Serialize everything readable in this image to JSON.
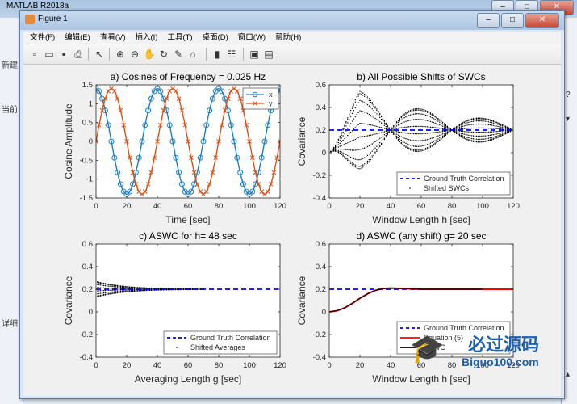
{
  "app": {
    "title": "MATLAB R2018a"
  },
  "side": {
    "left_labels": [
      "新建",
      "当前",
      "详细"
    ],
    "right_labels": [
      "?",
      "▾",
      "▴"
    ]
  },
  "figure": {
    "title": "Figure 1",
    "menus": [
      "文件(F)",
      "编辑(E)",
      "查看(V)",
      "插入(I)",
      "工具(T)",
      "桌面(D)",
      "窗口(W)",
      "帮助(H)"
    ],
    "toolbar_icons": [
      "new-file-icon",
      "open-icon",
      "save-icon",
      "print-icon",
      "pointer-icon",
      "zoom-in-icon",
      "zoom-out-icon",
      "pan-icon",
      "rotate-icon",
      "data-cursor-icon",
      "brush-icon",
      "colorbar-icon",
      "legend-icon",
      "plot-tools-hide-icon",
      "plot-tools-show-icon"
    ]
  },
  "colors": {
    "blue": "#1f7fc4",
    "orange": "#d95319",
    "gt": "#0000ff",
    "red": "#ff0000"
  },
  "chart_data": [
    {
      "type": "line",
      "title": "a) Cosines of Frequency = 0.025 Hz",
      "xlabel": "Time [sec]",
      "ylabel": "Cosine Amplitude",
      "xlim": [
        0,
        120
      ],
      "ylim": [
        -1.5,
        1.5
      ],
      "xticks": [
        "0",
        "20",
        "40",
        "60",
        "80",
        "100",
        "120"
      ],
      "yticks": [
        "-1.5",
        "-1",
        "-0.5",
        "0",
        "0.5",
        "1",
        "1.5"
      ],
      "legend_position": "top-right",
      "series": [
        {
          "name": "x",
          "frequency_hz": 0.025,
          "phase_sec": 0,
          "marker": "o",
          "color": "#1f7fc4"
        },
        {
          "name": "y",
          "frequency_hz": 0.025,
          "phase_sec": 10,
          "marker": "x",
          "color": "#d95319"
        }
      ]
    },
    {
      "type": "scatter",
      "title": "b) All Possible Shifts of SWCs",
      "xlabel": "Window Length h [sec]",
      "ylabel": "Covariance",
      "xlim": [
        0,
        120
      ],
      "ylim": [
        -0.4,
        0.6
      ],
      "xticks": [
        "0",
        "20",
        "40",
        "60",
        "80",
        "100",
        "120"
      ],
      "yticks": [
        "-0.4",
        "-0.2",
        "0",
        "0.2",
        "0.4",
        "0.6"
      ],
      "legend_position": "bottom-right",
      "ground_truth": 0.2,
      "series": [
        {
          "name": "Ground Truth Correlation",
          "style": "dashed",
          "color": "#0000ff"
        },
        {
          "name": "Shifted SWCs",
          "style": "dots",
          "color": "#000000"
        }
      ]
    },
    {
      "type": "scatter",
      "title": "c) ASWC for h= 48 sec",
      "xlabel": "Averaging Length g [sec]",
      "ylabel": "Covariance",
      "xlim": [
        0,
        120
      ],
      "ylim": [
        -0.4,
        0.6
      ],
      "xticks": [
        "0",
        "20",
        "40",
        "60",
        "80",
        "100",
        "120"
      ],
      "yticks": [
        "-0.4",
        "-0.2",
        "0",
        "0.2",
        "0.4",
        "0.6"
      ],
      "legend_position": "bottom-right",
      "ground_truth": 0.2,
      "series": [
        {
          "name": "Ground Truth Correlation",
          "style": "dashed",
          "color": "#0000ff"
        },
        {
          "name": "Shifted Averages",
          "style": "dots",
          "color": "#000000"
        }
      ]
    },
    {
      "type": "line",
      "title": "d) ASWC (any shift) g= 20 sec",
      "xlabel": "Window Length h [sec]",
      "ylabel": "Covariance",
      "xlim": [
        0,
        120
      ],
      "ylim": [
        -0.4,
        0.6
      ],
      "xticks": [
        "0",
        "20",
        "40",
        "60",
        "80",
        "100",
        "120"
      ],
      "yticks": [
        "-0.4",
        "-0.2",
        "0",
        "0.2",
        "0.4",
        "0.6"
      ],
      "legend_position": "bottom-right",
      "ground_truth": 0.2,
      "series": [
        {
          "name": "Ground Truth Correlation",
          "style": "dashed",
          "color": "#0000ff"
        },
        {
          "name": "Equation (5)",
          "style": "solid",
          "color": "#ff0000",
          "x": [
            0,
            5,
            10,
            15,
            20,
            25,
            30,
            35,
            40,
            50,
            60,
            80,
            100,
            120
          ],
          "y": [
            0,
            0.01,
            0.035,
            0.075,
            0.12,
            0.16,
            0.19,
            0.205,
            0.21,
            0.205,
            0.2,
            0.2,
            0.2,
            0.2
          ]
        },
        {
          "name": "ASWC",
          "style": "solid",
          "color": "#000000",
          "x": [
            0,
            5,
            10,
            15,
            20,
            25,
            30,
            35,
            40,
            50,
            60,
            80,
            100
          ],
          "y": [
            0,
            0.01,
            0.035,
            0.075,
            0.12,
            0.16,
            0.19,
            0.205,
            0.21,
            0.205,
            0.2,
            0.2,
            0.2
          ]
        }
      ]
    }
  ],
  "watermark": {
    "text": "必过源码",
    "sub": "Biguo100.com"
  }
}
